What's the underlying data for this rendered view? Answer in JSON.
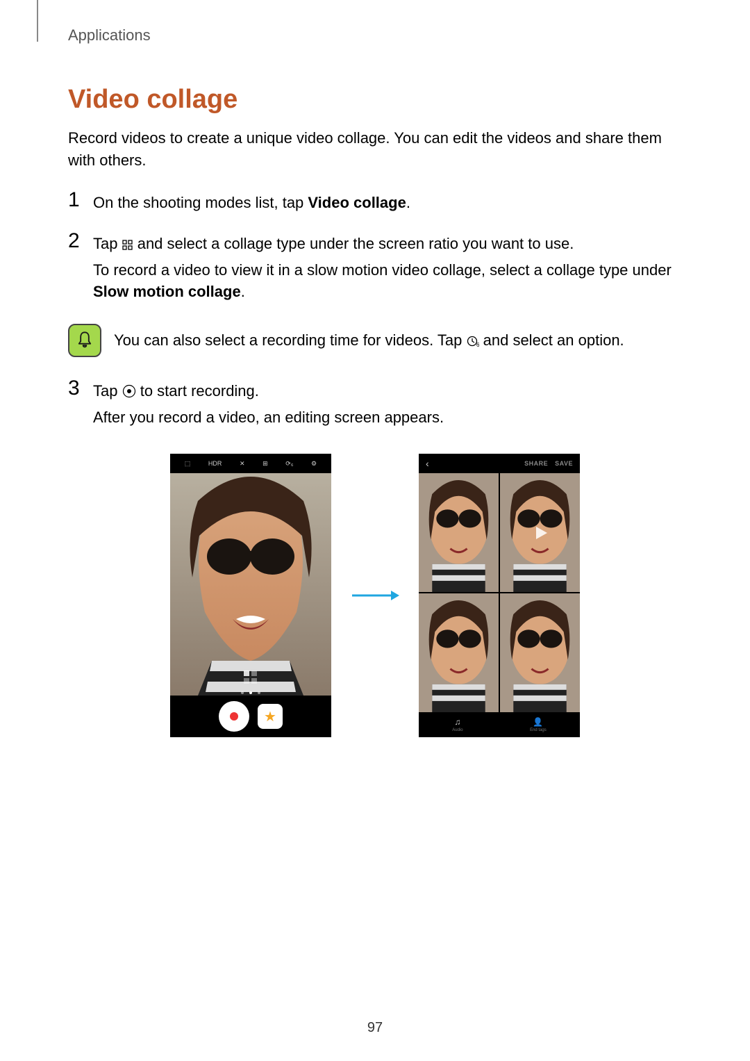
{
  "breadcrumb": "Applications",
  "section_title": "Video collage",
  "intro": "Record videos to create a unique video collage. You can edit the videos and share them with others.",
  "steps": {
    "s1": {
      "num": "1",
      "line1_a": "On the shooting modes list, tap ",
      "line1_b": "Video collage",
      "line1_c": "."
    },
    "s2": {
      "num": "2",
      "line1_a": "Tap ",
      "line1_b": " and select a collage type under the screen ratio you want to use.",
      "line2_a": "To record a video to view it in a slow motion video collage, select a collage type under ",
      "line2_b": "Slow motion collage",
      "line2_c": "."
    },
    "s3": {
      "num": "3",
      "line1_a": "Tap ",
      "line1_b": " to start recording.",
      "line2": "After you record a video, an editing screen appears."
    }
  },
  "note": {
    "text_a": "You can also select a recording time for videos. Tap ",
    "text_b": " and select an option."
  },
  "left_phone": {
    "topbar": {
      "i1": "⬚",
      "i2": "HDR",
      "i3": "✕",
      "i4": "⊞",
      "i5": "⟳₆",
      "i6": "⚙"
    },
    "star": "★"
  },
  "right_phone": {
    "back": "‹",
    "share": "SHARE",
    "save": "SAVE",
    "tool1": "Audio",
    "tool2": "End tags",
    "music": "♫",
    "person": "👤"
  },
  "page_number": "97"
}
